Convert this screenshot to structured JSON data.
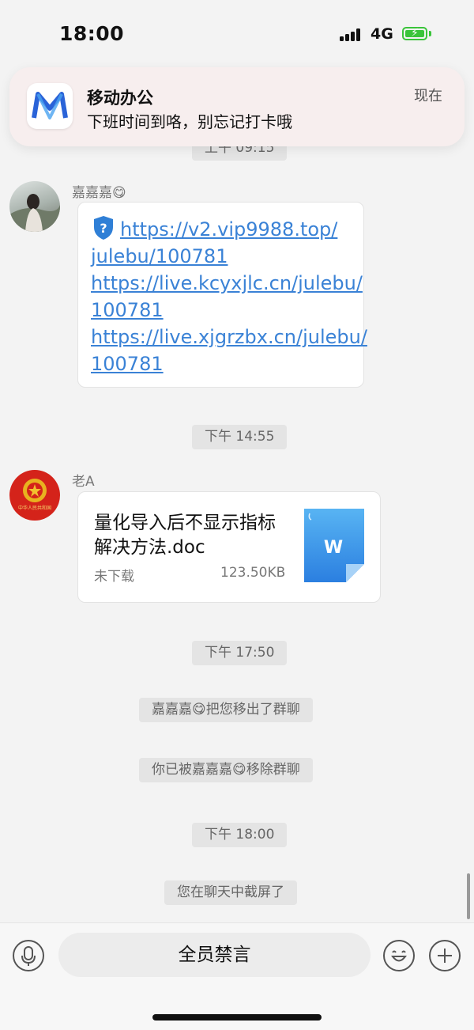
{
  "status_bar": {
    "time": "18:00",
    "network": "4G"
  },
  "notification": {
    "app_name": "移动办公",
    "message": "下班时间到咯，别忘记打卡哦",
    "time": "现在"
  },
  "chat": {
    "time_partial": "上午 09:15",
    "message1": {
      "sender": "嘉嘉嘉😋",
      "links": [
        "https://v2.vip9988.top/",
        "julebu/100781",
        "https://live.kcyxjlc.cn/julebu/",
        "100781",
        "https://live.xjgrzbx.cn/julebu/",
        "100781"
      ]
    },
    "time2": "下午 14:55",
    "message2": {
      "sender": "老A",
      "avatar_caption": "中华人民共和国",
      "file_name": "量化导入后不显示指标解决方法.doc",
      "file_status": "未下载",
      "file_size": "123.50KB",
      "file_icon_letter": "W"
    },
    "time3": "下午 17:50",
    "system1": "嘉嘉嘉😋把您移出了群聊",
    "system2": "你已被嘉嘉嘉😋移除群聊",
    "time4": "下午 18:00",
    "system3": "您在聊天中截屏了"
  },
  "input_bar": {
    "muted_text": "全员禁言"
  },
  "colors": {
    "link": "#3a82d6",
    "battery": "#3ac43a",
    "doc_icon": "#3b8fe6"
  }
}
